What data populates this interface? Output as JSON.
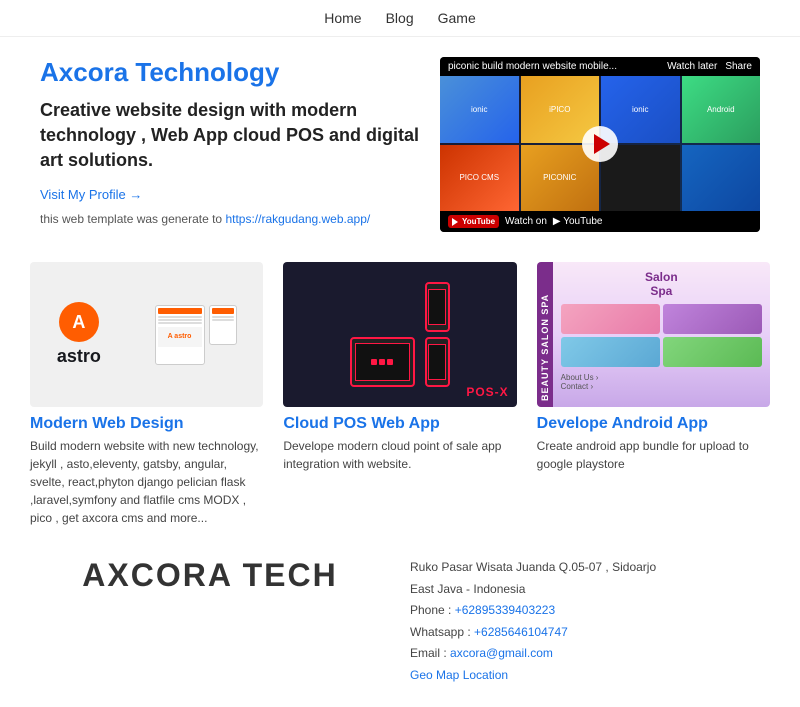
{
  "nav": {
    "items": [
      {
        "label": "Home",
        "href": "#"
      },
      {
        "label": "Blog",
        "href": "#"
      },
      {
        "label": "Game",
        "href": "#"
      }
    ]
  },
  "hero": {
    "title": "Axcora Technology",
    "tagline": "Creative website design with modern technology , Web App cloud POS and digital art solutions.",
    "profile_link": "Visit My Profile →",
    "template_note": "this web template was generate to ",
    "template_url": "https://rakgudang.web.app/",
    "template_url_text": "https://rakgudang.web.app/"
  },
  "video": {
    "title": "piconic build modern website mobile...",
    "watch_later": "Watch later",
    "share": "Share",
    "watch_on_youtube": "Watch on",
    "youtube_text": "YouTube"
  },
  "cards": [
    {
      "id": "modern-web",
      "title": "Modern Web Design",
      "description": "Build modern website with new technology, jekyll , asto,eleventy, gatsby, angular, svelte, react,phyton django pelician flask ,laravel,symfony and flatfile cms MODX , pico , get axcora cms and more..."
    },
    {
      "id": "cloud-pos",
      "title": "Cloud POS Web App",
      "description": "Develope modern cloud point of sale app integration with website."
    },
    {
      "id": "android",
      "title": "Develope Android App",
      "description": "Create android app bundle for upload to google playstore"
    }
  ],
  "footer": {
    "logo_text": "AXCORA TECH",
    "address": "Ruko Pasar Wisata Juanda Q.05-07 , Sidoarjo",
    "region": "East Java - Indonesia",
    "phone_label": "Phone : ",
    "phone": "+62895339403223",
    "whatsapp_label": "Whatsapp : ",
    "whatsapp": "+6285646104747",
    "email_label": "Email : ",
    "email": "axcora@gmail.com",
    "geo_map": "Geo Map Location"
  }
}
